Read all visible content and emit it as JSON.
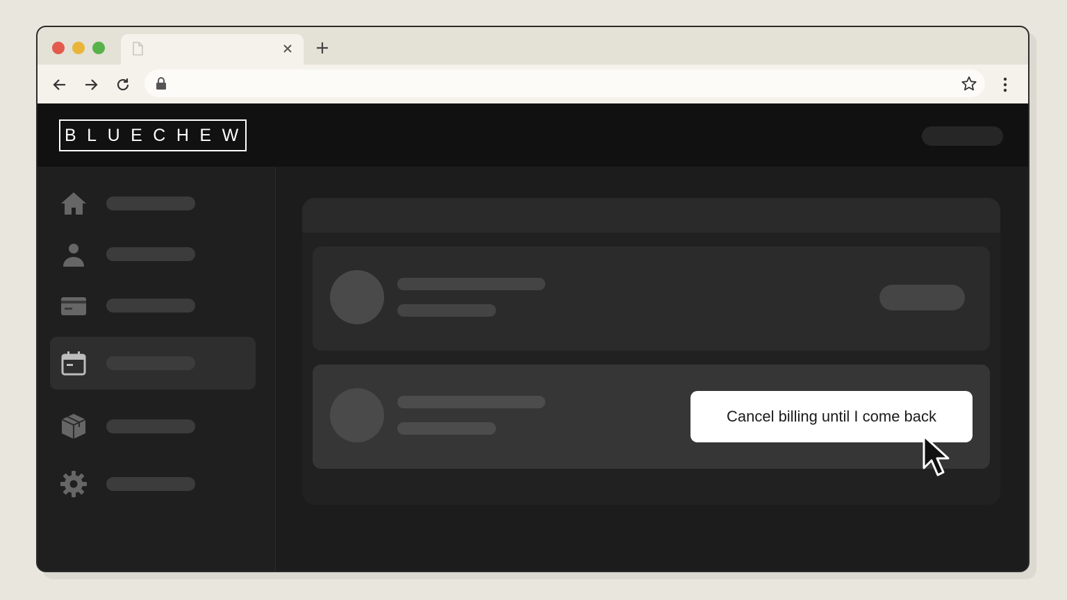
{
  "browser": {
    "tab": {
      "title": ""
    },
    "url": "",
    "icons": [
      "file-icon",
      "close-icon",
      "plus-icon",
      "back-arrow-icon",
      "forward-arrow-icon",
      "reload-icon",
      "lock-icon",
      "star-icon",
      "kebab-menu-icon"
    ]
  },
  "app": {
    "logo": "BLUECHEW",
    "sidebar": {
      "items": [
        {
          "icon": "home-icon",
          "active": false
        },
        {
          "icon": "user-icon",
          "active": false
        },
        {
          "icon": "credit-card-icon",
          "active": false
        },
        {
          "icon": "calendar-icon",
          "active": true
        },
        {
          "icon": "package-icon",
          "active": false
        },
        {
          "icon": "gear-icon",
          "active": false
        }
      ]
    },
    "main": {
      "cancel_button_label": "Cancel billing until I come back"
    }
  },
  "colors": {
    "accent": "#ffffff",
    "header_bg": "#111111",
    "sidebar_bg": "#1f1f1f",
    "traffic_red": "#e25b4d",
    "traffic_yellow": "#e8b53a",
    "traffic_green": "#57b24a"
  }
}
